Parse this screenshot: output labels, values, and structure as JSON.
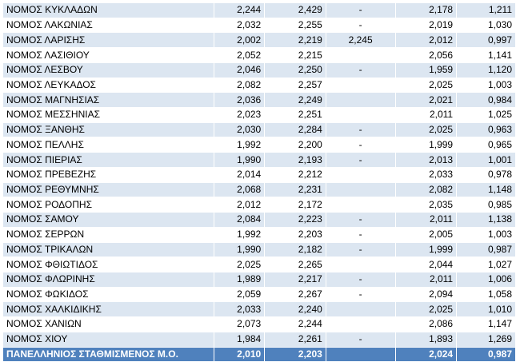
{
  "table": {
    "rows": [
      {
        "name": "ΝΟΜΟΣ ΚΥΚΛΑΔΩΝ",
        "v1": "2,244",
        "v2": "2,429",
        "v3": "-",
        "v4": "2,178",
        "v5": "1,211"
      },
      {
        "name": "ΝΟΜΟΣ ΛΑΚΩΝΙΑΣ",
        "v1": "2,032",
        "v2": "2,255",
        "v3": "-",
        "v4": "2,019",
        "v5": "1,030"
      },
      {
        "name": "ΝΟΜΟΣ ΛΑΡΙΣΗΣ",
        "v1": "2,002",
        "v2": "2,219",
        "v3": "2,245",
        "v4": "2,012",
        "v5": "0,997"
      },
      {
        "name": "ΝΟΜΟΣ ΛΑΣΙΘΙΟΥ",
        "v1": "2,052",
        "v2": "2,215",
        "v3": "",
        "v4": "2,056",
        "v5": "1,141"
      },
      {
        "name": "ΝΟΜΟΣ ΛΕΣΒΟΥ",
        "v1": "2,046",
        "v2": "2,250",
        "v3": "-",
        "v4": "1,959",
        "v5": "1,120"
      },
      {
        "name": "ΝΟΜΟΣ ΛΕΥΚΑΔΟΣ",
        "v1": "2,082",
        "v2": "2,257",
        "v3": "",
        "v4": "2,025",
        "v5": "1,003"
      },
      {
        "name": "ΝΟΜΟΣ ΜΑΓΝΗΣΙΑΣ",
        "v1": "2,036",
        "v2": "2,249",
        "v3": "",
        "v4": "2,021",
        "v5": "0,984"
      },
      {
        "name": "ΝΟΜΟΣ ΜΕΣΣΗΝΙΑΣ",
        "v1": "2,023",
        "v2": "2,251",
        "v3": "",
        "v4": "2,011",
        "v5": "1,025"
      },
      {
        "name": "ΝΟΜΟΣ ΞΑΝΘΗΣ",
        "v1": "2,030",
        "v2": "2,284",
        "v3": "-",
        "v4": "2,025",
        "v5": "0,963"
      },
      {
        "name": "ΝΟΜΟΣ ΠΕΛΛΗΣ",
        "v1": "1,992",
        "v2": "2,200",
        "v3": "-",
        "v4": "1,999",
        "v5": "0,965"
      },
      {
        "name": "ΝΟΜΟΣ ΠΙΕΡΙΑΣ",
        "v1": "1,990",
        "v2": "2,193",
        "v3": "-",
        "v4": "2,013",
        "v5": "1,001"
      },
      {
        "name": "ΝΟΜΟΣ ΠΡΕΒΕΖΗΣ",
        "v1": "2,014",
        "v2": "2,212",
        "v3": "",
        "v4": "2,033",
        "v5": "0,978"
      },
      {
        "name": "ΝΟΜΟΣ ΡΕΘΥΜΝΗΣ",
        "v1": "2,068",
        "v2": "2,231",
        "v3": "",
        "v4": "2,082",
        "v5": "1,148"
      },
      {
        "name": "ΝΟΜΟΣ ΡΟΔΟΠΗΣ",
        "v1": "2,012",
        "v2": "2,172",
        "v3": "",
        "v4": "2,035",
        "v5": "0,985"
      },
      {
        "name": "ΝΟΜΟΣ ΣΑΜΟΥ",
        "v1": "2,084",
        "v2": "2,223",
        "v3": "-",
        "v4": "2,011",
        "v5": "1,138"
      },
      {
        "name": "ΝΟΜΟΣ ΣΕΡΡΩΝ",
        "v1": "1,992",
        "v2": "2,203",
        "v3": "-",
        "v4": "2,005",
        "v5": "1,003"
      },
      {
        "name": "ΝΟΜΟΣ ΤΡΙΚΑΛΩΝ",
        "v1": "1,990",
        "v2": "2,182",
        "v3": "-",
        "v4": "1,999",
        "v5": "0,987"
      },
      {
        "name": "ΝΟΜΟΣ ΦΘΙΩΤΙΔΟΣ",
        "v1": "2,025",
        "v2": "2,265",
        "v3": "",
        "v4": "2,044",
        "v5": "1,027"
      },
      {
        "name": "ΝΟΜΟΣ ΦΛΩΡΙΝΗΣ",
        "v1": "1,989",
        "v2": "2,217",
        "v3": "-",
        "v4": "2,011",
        "v5": "1,006"
      },
      {
        "name": "ΝΟΜΟΣ ΦΩΚΙΔΟΣ",
        "v1": "2,059",
        "v2": "2,267",
        "v3": "-",
        "v4": "2,094",
        "v5": "1,058"
      },
      {
        "name": "ΝΟΜΟΣ ΧΑΛΚΙΔΙΚΗΣ",
        "v1": "2,033",
        "v2": "2,240",
        "v3": "",
        "v4": "2,025",
        "v5": "1,010"
      },
      {
        "name": "ΝΟΜΟΣ ΧΑΝΙΩΝ",
        "v1": "2,073",
        "v2": "2,244",
        "v3": "",
        "v4": "2,086",
        "v5": "1,147"
      },
      {
        "name": "ΝΟΜΟΣ ΧΙΟΥ",
        "v1": "1,984",
        "v2": "2,261",
        "v3": "-",
        "v4": "1,893",
        "v5": "1,269"
      }
    ],
    "total": {
      "name": "ΠΑΝΕΛΛΗΝΙΟΣ ΣΤΑΘΜΙΣΜΕΝΟΣ Μ.Ο.",
      "v1": "2,010",
      "v2": "2,203",
      "v3": "",
      "v4": "2,024",
      "v5": "0,987"
    }
  },
  "colors": {
    "row_band": "#dce6f1",
    "row_plain": "#ffffff",
    "total_bg": "#4f81bd",
    "total_text": "#ffffff"
  }
}
